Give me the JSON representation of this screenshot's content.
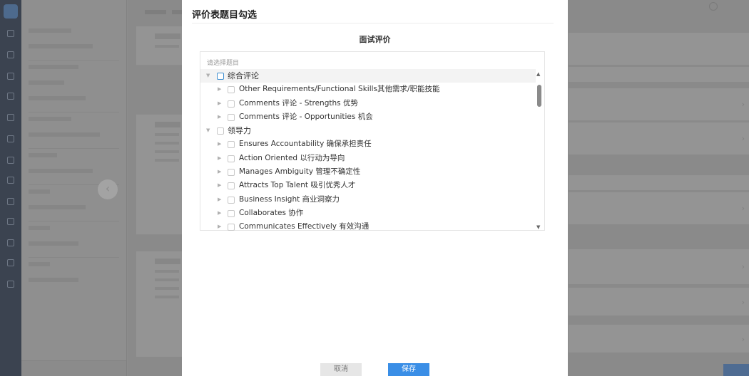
{
  "modal": {
    "title": "评价表题目勾选",
    "section_title": "面试评价",
    "select_placeholder": "请选择题目",
    "cancel_label": "取消",
    "save_label": "保存"
  },
  "tree": [
    {
      "label": "综合评论",
      "level": 0,
      "expanded": true,
      "highlighted": true
    },
    {
      "label": "Other Requirements/Functional Skills其他需求/职能技能",
      "level": 1
    },
    {
      "label": "Comments 评论 - Strengths 优势",
      "level": 1
    },
    {
      "label": "Comments 评论 - Opportunities 机会",
      "level": 1
    },
    {
      "label": "领导力",
      "level": 0,
      "expanded": true
    },
    {
      "label": "Ensures Accountability 确保承担责任",
      "level": 1
    },
    {
      "label": "Action Oriented 以行动为导向",
      "level": 1
    },
    {
      "label": "Manages Ambiguity 管理不确定性",
      "level": 1
    },
    {
      "label": "Attracts Top Talent 吸引优秀人才",
      "level": 1
    },
    {
      "label": "Business Insight 商业洞察力",
      "level": 1
    },
    {
      "label": "Collaborates 协作",
      "level": 1
    },
    {
      "label": "Communicates Effectively 有效沟通",
      "level": 1
    }
  ],
  "colors": {
    "primary": "#3a8ee6",
    "overlay": "#8d8d8d",
    "checkbox_accent": "#3e8ed0"
  }
}
